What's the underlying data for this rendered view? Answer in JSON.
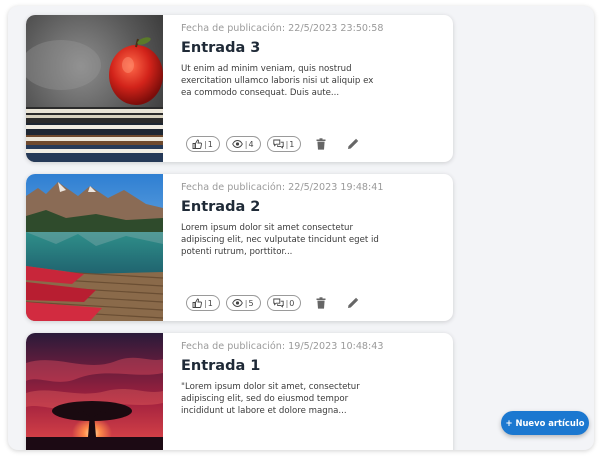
{
  "posts": [
    {
      "date": "Fecha de publicación: 22/5/2023 23:50:58",
      "title": "Entrada 3",
      "excerpt": "Ut enim ad minim veniam, quis nostrud exercitation ullamco laboris nisi ut aliquip ex ea commodo consequat. Duis aute...",
      "likes": "1",
      "views": "4",
      "comments": "1",
      "image": "apple-on-books"
    },
    {
      "date": "Fecha de publicación: 22/5/2023 19:48:41",
      "title": "Entrada 2",
      "excerpt": "Lorem ipsum dolor sit amet consectetur adipiscing elit, nec vulputate tincidunt eget id potenti rutrum, porttitor...",
      "likes": "1",
      "views": "5",
      "comments": "0",
      "image": "mountain-lake-boats"
    },
    {
      "date": "Fecha de publicación: 19/5/2023 10:48:43",
      "title": "Entrada 1",
      "excerpt": "\"Lorem ipsum dolor sit amet, consectetur adipiscing elit, sed do eiusmod tempor incididunt ut labore et dolore magna...",
      "image": "tree-red-sky"
    }
  ],
  "separator": "|",
  "icons": {
    "like": "thumbs-up-icon",
    "views": "eye-icon",
    "comments": "comment-icon",
    "delete": "trash-icon",
    "edit": "pencil-icon"
  },
  "new_button_label": "+ Nuevo artículo",
  "colors": {
    "accent": "#1b78d0",
    "background": "#f3f4f7",
    "title": "#1f2a37",
    "muted": "#9a9a9a"
  }
}
